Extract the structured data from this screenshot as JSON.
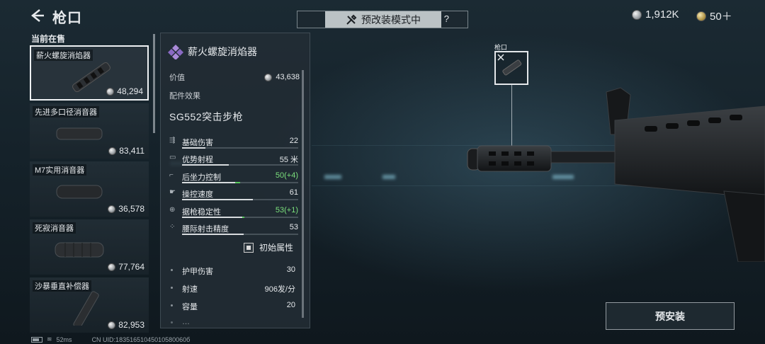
{
  "header": {
    "title": "枪口",
    "mode_label": "预改装模式中",
    "help": "?",
    "currency_silver": "1,912K",
    "currency_gold": "50＋"
  },
  "list": {
    "section_label": "当前在售",
    "items": [
      {
        "name": "薪火螺旋消焰器",
        "price": "48,294",
        "selected": true
      },
      {
        "name": "先进多口径消音器",
        "price": "83,411"
      },
      {
        "name": "M7实用消音器",
        "price": "36,578"
      },
      {
        "name": "死寂消音器",
        "price": "77,764"
      },
      {
        "name": "沙暴垂直补偿器",
        "price": "82,953"
      }
    ]
  },
  "detail": {
    "name": "薪火螺旋消焰器",
    "price_label": "价值",
    "price": "43,638",
    "effect_label": "配件效果",
    "weapon": "SG552突击步枪",
    "stats": [
      {
        "label": "基础伤害",
        "value": "22",
        "fill": 0.2
      },
      {
        "label": "优势射程",
        "value": "55 米",
        "fill": 0.4
      },
      {
        "label": "后坐力控制",
        "value": "50(+4)",
        "fill": 0.46,
        "gain": 0.04,
        "up": true
      },
      {
        "label": "操控速度",
        "value": "61",
        "fill": 0.61
      },
      {
        "label": "据枪稳定性",
        "value": "53(+1)",
        "fill": 0.52,
        "gain": 0.01,
        "up": true
      },
      {
        "label": "腰际射击精度",
        "value": "53",
        "fill": 0.53
      }
    ],
    "initial_toggle": "初始属性",
    "extras": [
      {
        "label": "护甲伤害",
        "value": "30"
      },
      {
        "label": "射速",
        "value": "906发/分"
      },
      {
        "label": "容量",
        "value": "20"
      },
      {
        "label": "…",
        "value": ""
      }
    ]
  },
  "preview": {
    "slot_label": "枪口"
  },
  "actions": {
    "preinstall": "预安装"
  },
  "status": {
    "ping": "52ms",
    "uid": "CN UID:18351651045010580060б"
  }
}
